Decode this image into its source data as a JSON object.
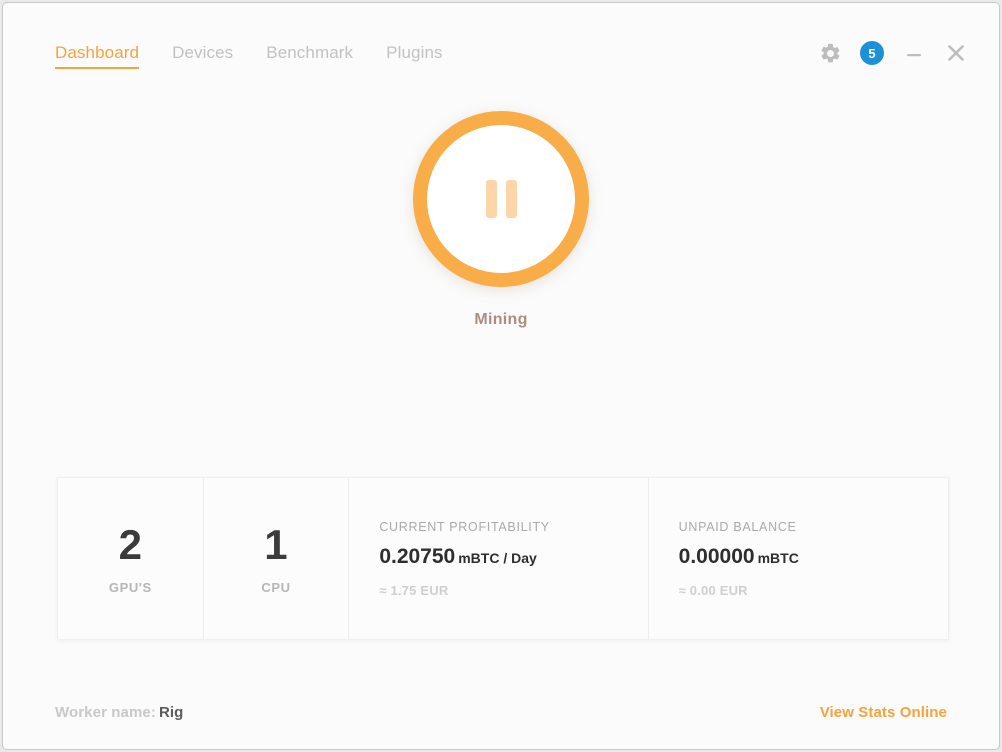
{
  "window": {
    "controls": {
      "settings_icon": "gear-icon",
      "notification_count": "5",
      "minimize_label": "—",
      "close_label": "✕"
    },
    "accent_color": "#f5a33c",
    "badge_color": "#1e90d8"
  },
  "tabs": [
    {
      "label": "Dashboard",
      "active": true
    },
    {
      "label": "Devices",
      "active": false
    },
    {
      "label": "Benchmark",
      "active": false
    },
    {
      "label": "Plugins",
      "active": false
    }
  ],
  "mining": {
    "button_icon": "pause-icon",
    "status": "Mining"
  },
  "stats": {
    "gpu": {
      "value": "2",
      "caption": "GPU'S"
    },
    "cpu": {
      "value": "1",
      "caption": "CPU"
    },
    "profitability": {
      "label": "CURRENT PROFITABILITY",
      "value": "0.20750",
      "unit": "mBTC / Day",
      "fiat": "≈ 1.75 EUR"
    },
    "balance": {
      "label": "UNPAID BALANCE",
      "value": "0.00000",
      "unit": "mBTC",
      "fiat": "≈ 0.00 EUR"
    }
  },
  "footer": {
    "worker_label": "Worker name:",
    "worker_name": "Rig",
    "stats_link": "View Stats Online"
  }
}
